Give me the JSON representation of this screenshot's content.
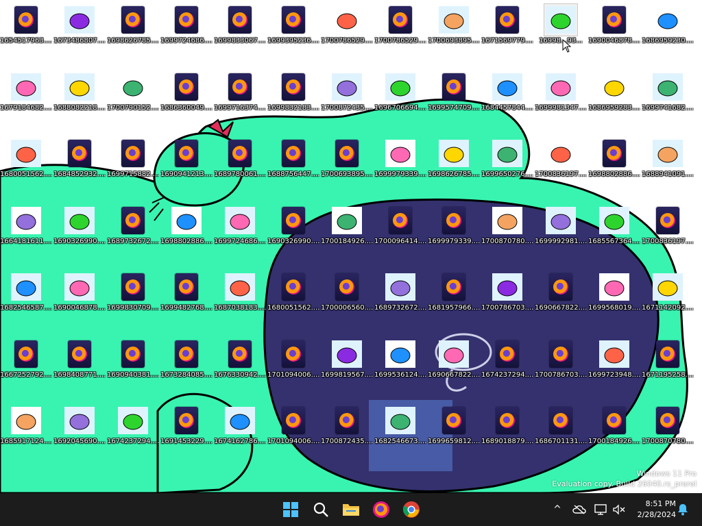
{
  "colors": {
    "wallpaper_bg": "#ffffff",
    "creature_green": "#38f4b0",
    "creature_blue": "#34316e",
    "outline": "#000000",
    "taskbar_bg": "#1c1c1c",
    "firefox_dark": "#1a1744"
  },
  "desktop_icons": [
    {
      "label": "1654517963....",
      "thumb": "firefox"
    },
    {
      "label": "1673486807....",
      "thumb": "image"
    },
    {
      "label": "1698626785....",
      "thumb": "firefox"
    },
    {
      "label": "1699724686....",
      "thumb": "firefox"
    },
    {
      "label": "1699833067....",
      "thumb": "firefox"
    },
    {
      "label": "1699395236....",
      "thumb": "firefox"
    },
    {
      "label": "1700786529....",
      "thumb": "image"
    },
    {
      "label": "1700786529....",
      "thumb": "firefox"
    },
    {
      "label": "1700693895....",
      "thumb": "image"
    },
    {
      "label": "1671569779....",
      "thumb": "firefox"
    },
    {
      "label": "16998...93...",
      "thumb": "image",
      "selected": true
    },
    {
      "label": "1690046878....",
      "thumb": "firefox"
    },
    {
      "label": "1686959230....",
      "thumb": "image"
    },
    {
      "label": "1679184682....",
      "thumb": "image"
    },
    {
      "label": "1688082218....",
      "thumb": "image"
    },
    {
      "label": "1700790152....",
      "thumb": "image"
    },
    {
      "label": "1686360049....",
      "thumb": "firefox"
    },
    {
      "label": "1699716374....",
      "thumb": "firefox"
    },
    {
      "label": "1699832183....",
      "thumb": "firefox"
    },
    {
      "label": "1700872435....",
      "thumb": "image"
    },
    {
      "label": "1696706694....",
      "thumb": "image"
    },
    {
      "label": "1699574709....",
      "thumb": "firefox"
    },
    {
      "label": "1684457844....",
      "thumb": "image"
    },
    {
      "label": "1699981347....",
      "thumb": "image"
    },
    {
      "label": "1686959283....",
      "thumb": "image"
    },
    {
      "label": "1699741682....",
      "thumb": "image"
    },
    {
      "label": "1680051562....",
      "thumb": "image"
    },
    {
      "label": "1684852932....",
      "thumb": "firefox"
    },
    {
      "label": "1699715882....",
      "thumb": "firefox"
    },
    {
      "label": "1690941213....",
      "thumb": "firefox"
    },
    {
      "label": "1689780061....",
      "thumb": "firefox"
    },
    {
      "label": "1688756447....",
      "thumb": "firefox"
    },
    {
      "label": "1700693895....",
      "thumb": "firefox"
    },
    {
      "label": "1699979339....",
      "thumb": "image"
    },
    {
      "label": "1698626785....",
      "thumb": "image"
    },
    {
      "label": "1699650276....",
      "thumb": "image"
    },
    {
      "label": "1700836197....",
      "thumb": "image"
    },
    {
      "label": "1698802886....",
      "thumb": "firefox"
    },
    {
      "label": "1688941091....",
      "thumb": "image"
    },
    {
      "label": "1664181611....",
      "thumb": "image"
    },
    {
      "label": "1690326990....",
      "thumb": "image"
    },
    {
      "label": "1689732672....",
      "thumb": "firefox"
    },
    {
      "label": "1698802886....",
      "thumb": "image"
    },
    {
      "label": "1699724686....",
      "thumb": "image"
    },
    {
      "label": "1690326990....",
      "thumb": "firefox"
    },
    {
      "label": "1700184926....",
      "thumb": "image"
    },
    {
      "label": "1700096414....",
      "thumb": "firefox"
    },
    {
      "label": "1699979339....",
      "thumb": "firefox"
    },
    {
      "label": "1700870780....",
      "thumb": "image"
    },
    {
      "label": "1699992981....",
      "thumb": "image"
    },
    {
      "label": "1685567364....",
      "thumb": "image"
    },
    {
      "label": "1700836197....",
      "thumb": "firefox"
    },
    {
      "label": "1682546587....",
      "thumb": "image"
    },
    {
      "label": "1690046878....",
      "thumb": "image"
    },
    {
      "label": "1699830709....",
      "thumb": "firefox"
    },
    {
      "label": "1699482768....",
      "thumb": "firefox"
    },
    {
      "label": "1687038183....",
      "thumb": "image"
    },
    {
      "label": "1680051562....",
      "thumb": "firefox"
    },
    {
      "label": "1700006560....",
      "thumb": "firefox"
    },
    {
      "label": "1689732672....",
      "thumb": "image"
    },
    {
      "label": "1681957966....",
      "thumb": "firefox"
    },
    {
      "label": "1700786703....",
      "thumb": "image"
    },
    {
      "label": "1690667822....",
      "thumb": "firefox"
    },
    {
      "label": "1699568019....",
      "thumb": "image"
    },
    {
      "label": "1671142092....",
      "thumb": "image"
    },
    {
      "label": "1667252792....",
      "thumb": "firefox"
    },
    {
      "label": "1698408771....",
      "thumb": "firefox"
    },
    {
      "label": "1690940381....",
      "thumb": "firefox"
    },
    {
      "label": "1673284085....",
      "thumb": "firefox"
    },
    {
      "label": "1676330942....",
      "thumb": "firefox"
    },
    {
      "label": "1701094006....",
      "thumb": "firefox"
    },
    {
      "label": "1699819567....",
      "thumb": "image"
    },
    {
      "label": "1699536124....",
      "thumb": "image"
    },
    {
      "label": "1690667822....",
      "thumb": "image"
    },
    {
      "label": "1674237294....",
      "thumb": "firefox"
    },
    {
      "label": "1700786703....",
      "thumb": "firefox"
    },
    {
      "label": "1699723948....",
      "thumb": "image"
    },
    {
      "label": "1671195258....",
      "thumb": "firefox"
    },
    {
      "label": "1685917124....",
      "thumb": "image"
    },
    {
      "label": "1692045690....",
      "thumb": "image"
    },
    {
      "label": "1674237294....",
      "thumb": "image"
    },
    {
      "label": "1691453229....",
      "thumb": "firefox"
    },
    {
      "label": "1674162786....",
      "thumb": "image"
    },
    {
      "label": "1701094006....",
      "thumb": "firefox"
    },
    {
      "label": "1700872435....",
      "thumb": "firefox"
    },
    {
      "label": "1682546673....",
      "thumb": "image"
    },
    {
      "label": "1699659812....",
      "thumb": "firefox"
    },
    {
      "label": "1689018879....",
      "thumb": "firefox"
    },
    {
      "label": "1686701131....",
      "thumb": "firefox"
    },
    {
      "label": "1700184926....",
      "thumb": "firefox"
    },
    {
      "label": "1700870780....",
      "thumb": "firefox"
    }
  ],
  "watermark": {
    "line1": "Windows 11 Pro",
    "line2": "Evaluation copy. Build 26040.rs_prerel"
  },
  "taskbar": {
    "apps": [
      {
        "name": "start",
        "icon": "windows-logo-icon"
      },
      {
        "name": "search",
        "icon": "search-icon"
      },
      {
        "name": "file-explorer",
        "icon": "folder-icon"
      },
      {
        "name": "firefox",
        "icon": "firefox-icon"
      },
      {
        "name": "chrome",
        "icon": "chrome-icon"
      }
    ],
    "tray": {
      "chevron": "^",
      "time": "8:51 PM",
      "date": "2/28/2024"
    }
  }
}
